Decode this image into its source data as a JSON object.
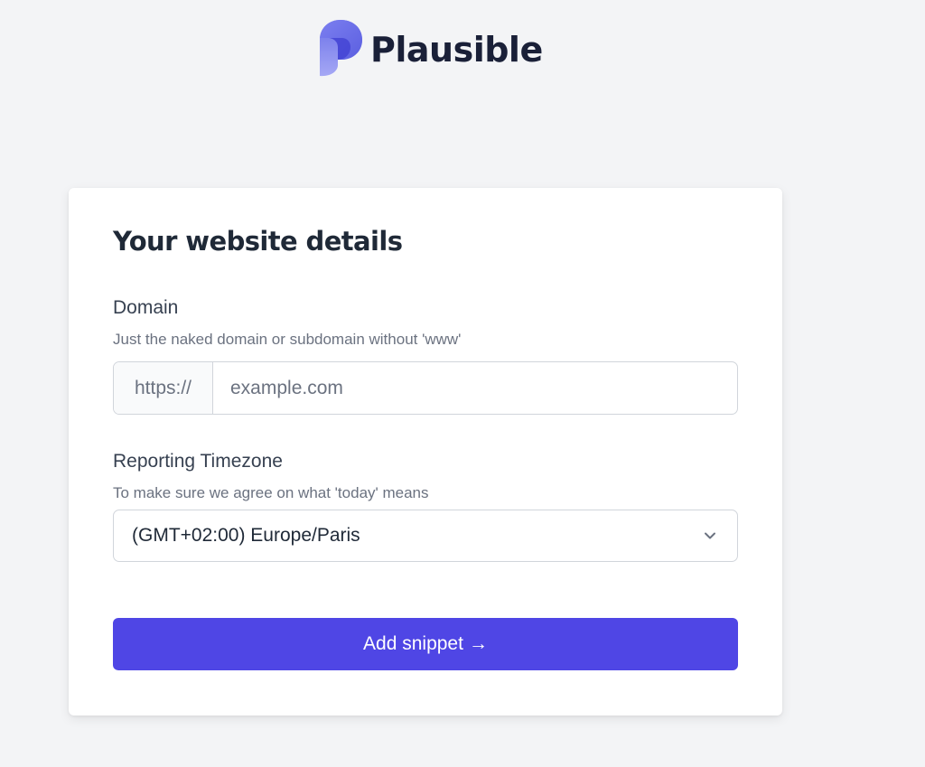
{
  "brand": {
    "name": "Plausible",
    "logo_icon": "plausible-logo-icon",
    "logo_colors": [
      "#5850ec",
      "#8b87f5"
    ]
  },
  "form": {
    "title": "Your website details",
    "domain": {
      "label": "Domain",
      "hint": "Just the naked domain or subdomain without 'www'",
      "prefix": "https://",
      "placeholder": "example.com",
      "value": ""
    },
    "timezone": {
      "label": "Reporting Timezone",
      "hint": "To make sure we agree on what 'today' means",
      "selected": "(GMT+02:00) Europe/Paris",
      "icon": "chevron-down-icon"
    },
    "submit": {
      "label": "Add snippet",
      "arrow": "→",
      "color": "#4f46e5"
    }
  },
  "colors": {
    "background": "#f3f4f6",
    "card": "#ffffff",
    "accent": "#4f46e5"
  }
}
